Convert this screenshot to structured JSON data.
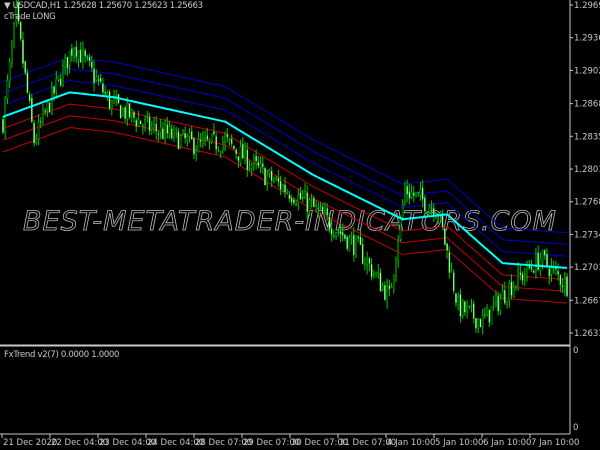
{
  "header": {
    "symbol_line": "▼ USDCAD,H1  1.25628 1.25670 1.25623 1.25663",
    "strategy": "cTrade LONG"
  },
  "subwindow": {
    "label": "FxTrend v2(7) 0.0000 1.0000",
    "axis_top": "0",
    "axis_bottom": "0"
  },
  "watermark": "BEST-METATRADER-INDICATORS.COM",
  "colors": {
    "bull": "#00c800",
    "ma": "#00ffff",
    "upper": "#0000c8",
    "lower": "#c80000",
    "axis": "#c8c8c8"
  },
  "chart_data": {
    "type": "candlestick",
    "symbol": "USDCAD",
    "timeframe": "H1",
    "y_ticks": [
      "1.29695",
      "1.29360",
      "1.29025",
      "1.28685",
      "1.28350",
      "1.28015",
      "1.27680",
      "1.27345",
      "1.27010",
      "1.26670",
      "1.26335"
    ],
    "ylim": [
      1.262,
      1.2975
    ],
    "x_ticks": [
      "21 Dec 2020",
      "22 Dec 04:00",
      "23 Dec 04:00",
      "24 Dec 04:00",
      "28 Dec 07:00",
      "29 Dec 07:00",
      "30 Dec 07:00",
      "31 Dec 07:00",
      "4 Jan 10:00",
      "5 Jan 10:00",
      "6 Jan 10:00",
      "7 Jan 10:00"
    ],
    "n_bars": 255,
    "close_path": [
      [
        0,
        1.285
      ],
      [
        6,
        1.296
      ],
      [
        14,
        1.283
      ],
      [
        32,
        1.293
      ],
      [
        48,
        1.287
      ],
      [
        65,
        1.2845
      ],
      [
        88,
        1.2825
      ],
      [
        100,
        1.283
      ],
      [
        118,
        1.2795
      ],
      [
        138,
        1.2765
      ],
      [
        160,
        1.272
      ],
      [
        174,
        1.267
      ],
      [
        181,
        1.278
      ],
      [
        196,
        1.276
      ],
      [
        205,
        1.266
      ],
      [
        216,
        1.2645
      ],
      [
        228,
        1.268
      ],
      [
        242,
        1.271
      ],
      [
        255,
        1.268
      ]
    ],
    "ma_path": [
      [
        0,
        1.2855
      ],
      [
        30,
        1.288
      ],
      [
        50,
        1.2875
      ],
      [
        100,
        1.285
      ],
      [
        140,
        1.2795
      ],
      [
        180,
        1.275
      ],
      [
        200,
        1.2755
      ],
      [
        225,
        1.2705
      ],
      [
        255,
        1.27
      ]
    ],
    "band_offsets": [
      0.0012,
      0.0024,
      0.0036
    ]
  }
}
